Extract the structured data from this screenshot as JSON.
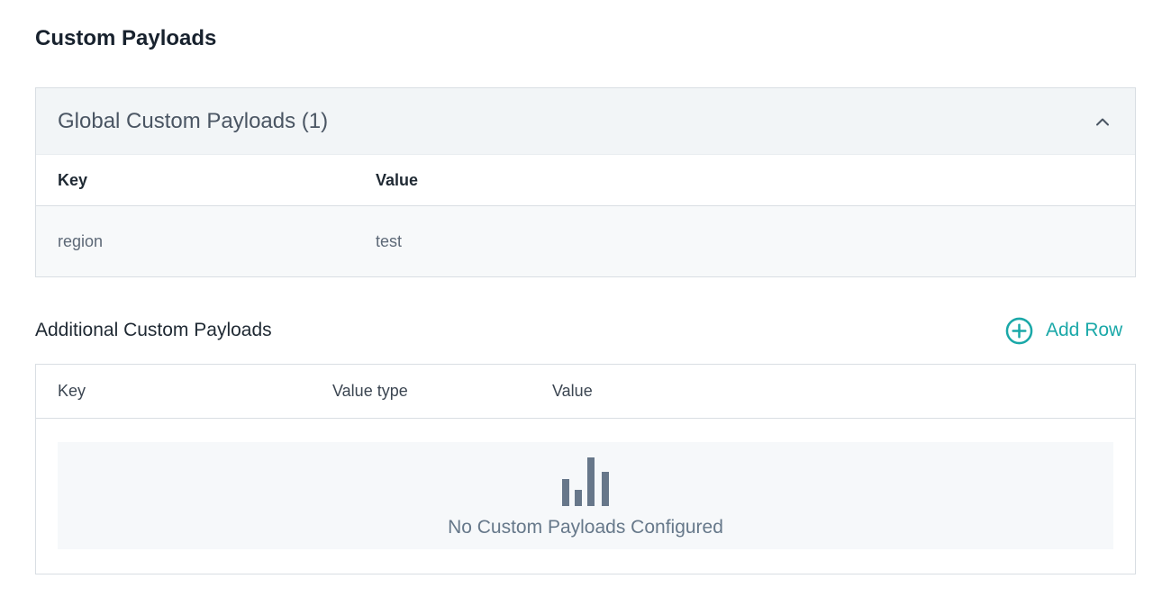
{
  "page": {
    "title": "Custom Payloads"
  },
  "global": {
    "title": "Global Custom Payloads (1)",
    "columns": {
      "key": "Key",
      "value": "Value"
    },
    "rows": [
      {
        "key": "region",
        "value": "test"
      }
    ],
    "collapse_icon": "chevron-up-icon"
  },
  "additional": {
    "title": "Additional Custom Payloads",
    "add_row_label": "Add Row",
    "add_row_icon": "plus-circle-icon",
    "columns": {
      "key": "Key",
      "value_type": "Value type",
      "value": "Value"
    },
    "empty_icon": "bar-chart-icon",
    "empty_text": "No Custom Payloads Configured"
  },
  "colors": {
    "accent": "#1aa8a8",
    "empty_icon": "#67778a",
    "header_bg": "#f2f5f7",
    "border": "#d9dee3"
  }
}
